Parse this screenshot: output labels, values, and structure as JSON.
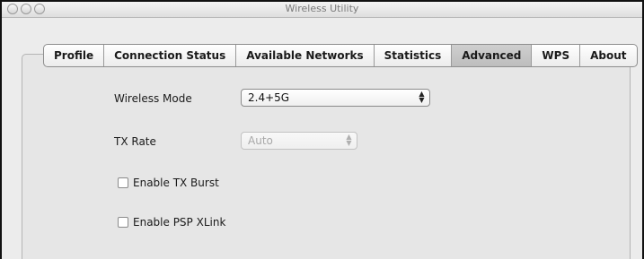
{
  "window": {
    "title": "Wireless Utility"
  },
  "tabs": [
    {
      "label": "Profile",
      "active": false
    },
    {
      "label": "Connection Status",
      "active": false
    },
    {
      "label": "Available Networks",
      "active": false
    },
    {
      "label": "Statistics",
      "active": false
    },
    {
      "label": "Advanced",
      "active": true
    },
    {
      "label": "WPS",
      "active": false
    },
    {
      "label": "About",
      "active": false
    }
  ],
  "advanced": {
    "wireless_mode": {
      "label": "Wireless Mode",
      "value": "2.4+5G"
    },
    "tx_rate": {
      "label": "TX Rate",
      "value": "Auto",
      "enabled": false
    },
    "enable_tx_burst": {
      "label": "Enable TX Burst",
      "checked": false
    },
    "enable_psp_xlink": {
      "label": "Enable PSP XLink",
      "checked": false
    }
  }
}
